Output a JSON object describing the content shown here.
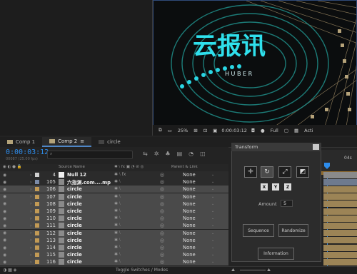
{
  "viewer": {
    "logo_text": "云报讯",
    "logo_sub": "H U B E R",
    "zoom": "25%",
    "timecode": "0:00:03:12",
    "resolution": "Full",
    "more": "Acti"
  },
  "tabs": [
    {
      "label": "Comp 1",
      "color": "#b3a37a"
    },
    {
      "label": "Comp 2",
      "color": "#b3a37a",
      "active": true
    },
    {
      "label": "circle",
      "color": "#444444"
    }
  ],
  "timeline": {
    "timecode": "0:00:03:12",
    "timecode_sub": "00087 (25.00 fps)",
    "search_placeholder": "",
    "col_source": "Source Name",
    "col_parent": "Parent & Link",
    "ruler_label": "04s"
  },
  "layers": [
    {
      "num": "4",
      "name": "Null 12",
      "sel": false,
      "label_color": "#d0d0d0",
      "fx": true,
      "parent": "None"
    },
    {
      "num": "105",
      "name": "六指渊.com....mp",
      "sel": false,
      "label_color": "#7b8ba8",
      "fx": false,
      "parent": "None"
    },
    {
      "num": "106",
      "name": "circle",
      "sel": true,
      "label_color": "#c29a55",
      "fx": false,
      "parent": "None"
    },
    {
      "num": "107",
      "name": "circle",
      "sel": true,
      "label_color": "#c29a55",
      "fx": false,
      "parent": "None"
    },
    {
      "num": "108",
      "name": "circle",
      "sel": true,
      "label_color": "#c29a55",
      "fx": false,
      "parent": "None"
    },
    {
      "num": "109",
      "name": "circle",
      "sel": true,
      "label_color": "#c29a55",
      "fx": false,
      "parent": "None"
    },
    {
      "num": "110",
      "name": "circle",
      "sel": true,
      "label_color": "#c29a55",
      "fx": false,
      "parent": "None"
    },
    {
      "num": "111",
      "name": "circle",
      "sel": true,
      "label_color": "#c29a55",
      "fx": false,
      "parent": "None"
    },
    {
      "num": "112",
      "name": "circle",
      "sel": true,
      "label_color": "#c29a55",
      "fx": false,
      "parent": "None"
    },
    {
      "num": "113",
      "name": "circle",
      "sel": true,
      "label_color": "#c29a55",
      "fx": false,
      "parent": "None"
    },
    {
      "num": "114",
      "name": "circle",
      "sel": true,
      "label_color": "#c29a55",
      "fx": false,
      "parent": "None"
    },
    {
      "num": "115",
      "name": "circle",
      "sel": true,
      "label_color": "#c29a55",
      "fx": false,
      "parent": "None"
    },
    {
      "num": "116",
      "name": "circle",
      "sel": true,
      "label_color": "#c29a55",
      "fx": false,
      "parent": "None"
    }
  ],
  "dialog": {
    "title": "Transform",
    "amount_label": "Amount",
    "amount_value": "5",
    "axis": [
      "X",
      "Y",
      "Z"
    ],
    "sequence": "Sequence",
    "randomize": "Randomize",
    "information": "Information"
  },
  "bottom": {
    "toggle": "Toggle Switches / Modes"
  },
  "colors": {
    "accent": "#2d8ceb",
    "selected_row": "#4a4a4a",
    "workbar": "#8f6a2d"
  }
}
